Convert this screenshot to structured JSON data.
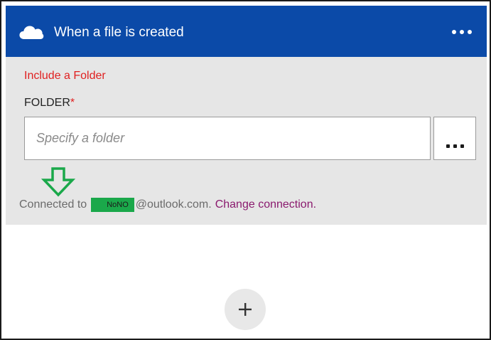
{
  "header": {
    "title": "When a file is created",
    "icon": "onedrive-cloud-icon",
    "more_icon": "more-options-icon"
  },
  "form": {
    "section_title": "Include a Folder",
    "folder_label": "FOLDER",
    "required_marker": "*",
    "folder_placeholder": "Specify a folder",
    "folder_value": "",
    "browse_icon": "ellipsis-icon"
  },
  "connection": {
    "prefix": "Connected to",
    "redacted_user": "NoNO",
    "domain": "@outlook.com.",
    "change_link": "Change connection."
  },
  "annotation": {
    "arrow_icon": "green-down-arrow-icon"
  },
  "add_step": {
    "icon": "plus-icon"
  },
  "colors": {
    "header_bg": "#0b4aa8",
    "card_bg": "#e6e6e6",
    "error_red": "#e02020",
    "link_purple": "#8a1a6e",
    "annotation_green": "#1aa84a"
  }
}
